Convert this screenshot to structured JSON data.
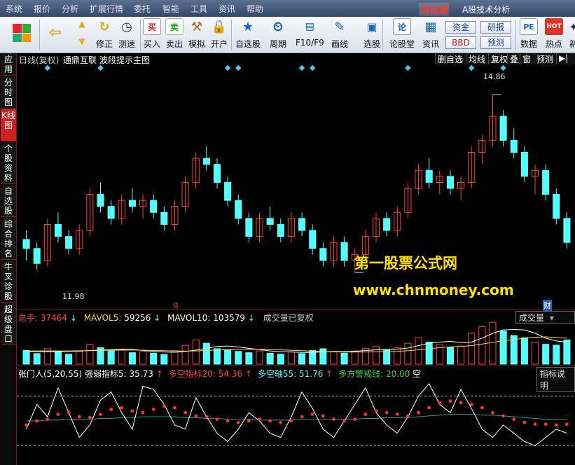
{
  "menu": {
    "items": [
      "系统",
      "报价",
      "分析",
      "扩展行情",
      "委托",
      "智能",
      "工具",
      "资讯",
      "帮助"
    ],
    "brand": "同花顺",
    "app_title": "A股技术分析"
  },
  "toolbar": {
    "buttons": [
      {
        "label": "修正",
        "icon": "refresh-icon"
      },
      {
        "label": "测速",
        "icon": "clock-icon"
      },
      {
        "label": "买入",
        "icon": "buy-icon",
        "glyph": "买"
      },
      {
        "label": "卖出",
        "icon": "sell-icon",
        "glyph": "卖"
      },
      {
        "label": "模拟",
        "icon": "gavel-icon"
      },
      {
        "label": "开户",
        "icon": "lock-icon"
      },
      {
        "label": "自选股",
        "icon": "star-icon"
      },
      {
        "label": "周期",
        "icon": "period-icon"
      },
      {
        "label": "F10/F9",
        "icon": "f10-icon"
      },
      {
        "label": "画线",
        "icon": "pencil-icon"
      },
      {
        "label": "选股",
        "icon": "select-icon"
      },
      {
        "label": "论股堂",
        "icon": "forum-icon",
        "glyph": "论"
      },
      {
        "label": "资讯",
        "icon": "news-icon"
      },
      {
        "label": "数据",
        "icon": "data-icon",
        "glyph": "PE"
      },
      {
        "label": "热点",
        "icon": "hot-icon",
        "glyph": "HOT"
      },
      {
        "label": "新",
        "icon": "new-icon"
      }
    ],
    "small_buttons": {
      "fund": "资金",
      "bbd": "BBD",
      "research": "研报",
      "forecast": "预测"
    }
  },
  "left_tabs": [
    "应用",
    "分时图",
    "K线图",
    "个股资料",
    "自选股",
    "综合排名",
    "牛叉诊股",
    "超级盘口"
  ],
  "chart_header": {
    "period": "日线(复权)",
    "stock": "通鼎互联",
    "indicator": "波段提示主图",
    "right_buttons": [
      "删自选",
      "均线",
      "复权",
      "叠",
      "窗",
      "预测"
    ]
  },
  "price_chart": {
    "high_label": "14.86",
    "low_label": "11.98",
    "marker_q": "q",
    "marker_cai": "财"
  },
  "watermark": {
    "line1": "第一股票公式网",
    "line2": "www.chnmoney.com"
  },
  "volume": {
    "total_label": "总手:",
    "total_value": "37464",
    "ma5_label": "MAVOL5:",
    "ma5_value": "59256",
    "ma10_label": "MAVOL10:",
    "ma10_value": "103579",
    "note": "成交量已复权",
    "selector": "成交量",
    "arrow_up": "↑",
    "arrow_down": "↓"
  },
  "indicator": {
    "name": "张门人(5,20,55)",
    "s1": "强弱指标5:",
    "v1": "35.73",
    "s2": "多空指标20:",
    "v2": "54.36",
    "s3": "多空轴55:",
    "v3": "51.76",
    "s4": "多方警戒线:",
    "v4": "20.00",
    "suffix": "空",
    "help": "指标说明"
  },
  "colors": {
    "up": "#ff4040",
    "down": "#54ffff",
    "bg": "#000000",
    "marker": "#4fc3f7",
    "ma5": "#ffffff",
    "ma10": "#ffd54f",
    "dots": "#ff3030",
    "accent": "#c22222"
  },
  "chart_data": {
    "type": "candlestick",
    "price_range": [
      11.4,
      15.2
    ],
    "candles": [
      [
        12.45,
        12.6,
        12.1,
        12.3
      ],
      [
        12.3,
        12.4,
        11.95,
        12.05
      ],
      [
        12.1,
        12.8,
        12.0,
        12.7
      ],
      [
        12.7,
        12.9,
        12.4,
        12.5
      ],
      [
        12.5,
        12.6,
        12.2,
        12.3
      ],
      [
        12.3,
        12.7,
        12.2,
        12.6
      ],
      [
        12.6,
        13.3,
        12.5,
        13.2
      ],
      [
        13.2,
        13.4,
        12.9,
        13.0
      ],
      [
        13.0,
        13.1,
        12.7,
        12.8
      ],
      [
        12.8,
        13.2,
        12.7,
        13.1
      ],
      [
        13.1,
        13.3,
        12.9,
        13.0
      ],
      [
        13.0,
        13.2,
        12.8,
        13.1
      ],
      [
        13.1,
        13.2,
        12.8,
        12.9
      ],
      [
        12.9,
        13.0,
        12.6,
        12.7
      ],
      [
        12.7,
        13.1,
        12.6,
        13.0
      ],
      [
        13.0,
        13.5,
        12.9,
        13.4
      ],
      [
        13.4,
        13.9,
        13.3,
        13.8
      ],
      [
        13.8,
        14.0,
        13.6,
        13.7
      ],
      [
        13.7,
        13.8,
        13.3,
        13.4
      ],
      [
        13.4,
        13.5,
        13.0,
        13.1
      ],
      [
        13.1,
        13.2,
        12.7,
        12.8
      ],
      [
        12.8,
        12.9,
        12.4,
        12.5
      ],
      [
        12.5,
        12.9,
        12.4,
        12.8
      ],
      [
        12.8,
        13.0,
        12.6,
        12.7
      ],
      [
        12.7,
        12.8,
        12.4,
        12.5
      ],
      [
        12.5,
        12.9,
        12.4,
        12.8
      ],
      [
        12.8,
        12.9,
        12.5,
        12.6
      ],
      [
        12.6,
        12.7,
        12.2,
        12.3
      ],
      [
        12.3,
        12.4,
        12.0,
        12.1
      ],
      [
        12.1,
        12.5,
        12.0,
        12.4
      ],
      [
        12.4,
        12.5,
        12.0,
        12.1
      ],
      [
        12.1,
        12.3,
        11.9,
        12.2
      ],
      [
        12.2,
        12.6,
        12.1,
        12.5
      ],
      [
        12.5,
        12.9,
        12.4,
        12.8
      ],
      [
        12.8,
        12.9,
        12.5,
        12.6
      ],
      [
        12.6,
        13.0,
        12.5,
        12.9
      ],
      [
        12.9,
        13.4,
        12.8,
        13.3
      ],
      [
        13.3,
        13.7,
        13.2,
        13.6
      ],
      [
        13.6,
        13.8,
        13.3,
        13.4
      ],
      [
        13.4,
        13.6,
        13.2,
        13.5
      ],
      [
        13.5,
        13.6,
        13.2,
        13.3
      ],
      [
        13.3,
        13.5,
        13.1,
        13.4
      ],
      [
        13.4,
        14.0,
        13.3,
        13.9
      ],
      [
        13.9,
        14.2,
        13.7,
        14.1
      ],
      [
        14.1,
        14.86,
        14.0,
        14.5
      ],
      [
        14.5,
        14.6,
        14.0,
        14.1
      ],
      [
        14.1,
        14.3,
        13.8,
        13.9
      ],
      [
        13.9,
        14.0,
        13.4,
        13.5
      ],
      [
        13.5,
        13.7,
        13.2,
        13.6
      ],
      [
        13.6,
        13.7,
        13.1,
        13.2
      ],
      [
        13.2,
        13.3,
        12.7,
        12.8
      ],
      [
        12.8,
        12.9,
        12.3,
        12.4
      ]
    ],
    "volume": [
      62,
      48,
      70,
      55,
      45,
      58,
      90,
      75,
      60,
      66,
      52,
      58,
      50,
      44,
      61,
      85,
      110,
      95,
      70,
      64,
      58,
      52,
      60,
      49,
      45,
      55,
      48,
      62,
      70,
      58,
      50,
      60,
      72,
      80,
      66,
      74,
      95,
      120,
      100,
      88,
      76,
      82,
      140,
      170,
      190,
      150,
      130,
      120,
      100,
      90,
      86,
      110
    ],
    "ma5": [
      57,
      57,
      56,
      57,
      58,
      59,
      62,
      64,
      66,
      68,
      67,
      62,
      58,
      55,
      54,
      57,
      64,
      72,
      80,
      82,
      78,
      72,
      66,
      60,
      57,
      55,
      53,
      53,
      56,
      57,
      57,
      58,
      62,
      65,
      66,
      68,
      73,
      84,
      95,
      100,
      103,
      98,
      100,
      118,
      140,
      155,
      157,
      155,
      140,
      118,
      105,
      100
    ],
    "ma10": [
      60,
      60,
      60,
      60,
      60,
      61,
      61,
      62,
      63,
      64,
      64,
      63,
      62,
      61,
      60,
      59,
      60,
      62,
      64,
      66,
      67,
      68,
      67,
      66,
      65,
      63,
      61,
      59,
      57,
      56,
      55,
      55,
      55,
      56,
      57,
      58,
      61,
      65,
      70,
      75,
      78,
      80,
      84,
      91,
      99,
      106,
      112,
      118,
      122,
      124,
      121,
      118
    ],
    "strong5": [
      40,
      70,
      55,
      90,
      60,
      30,
      45,
      75,
      85,
      60,
      40,
      92,
      88,
      70,
      45,
      40,
      78,
      55,
      35,
      25,
      40,
      60,
      50,
      35,
      30,
      55,
      85,
      65,
      40,
      30,
      50,
      70,
      90,
      60,
      45,
      35,
      55,
      80,
      95,
      70,
      60,
      88,
      65,
      40,
      30,
      45,
      35,
      25,
      20,
      30,
      40,
      35
    ],
    "multi20": [
      45,
      50,
      52,
      58,
      60,
      55,
      54,
      58,
      64,
      66,
      62,
      60,
      64,
      68,
      66,
      60,
      56,
      55,
      52,
      50,
      48,
      50,
      52,
      50,
      48,
      50,
      55,
      58,
      56,
      52,
      50,
      52,
      58,
      62,
      60,
      58,
      56,
      60,
      66,
      72,
      74,
      72,
      70,
      66,
      60,
      56,
      52,
      48,
      46,
      46,
      45,
      46
    ],
    "axis55": [
      50,
      50,
      51,
      51,
      52,
      52,
      52,
      53,
      53,
      54,
      54,
      55,
      55,
      55,
      55,
      54,
      54,
      53,
      53,
      52,
      52,
      52,
      51,
      51,
      51,
      51,
      52,
      52,
      52,
      52,
      52,
      52,
      53,
      53,
      54,
      54,
      54,
      55,
      56,
      57,
      58,
      58,
      58,
      57,
      57,
      56,
      55,
      54,
      53,
      52,
      52,
      52
    ],
    "alert_line": 20,
    "upper_line": 80
  }
}
